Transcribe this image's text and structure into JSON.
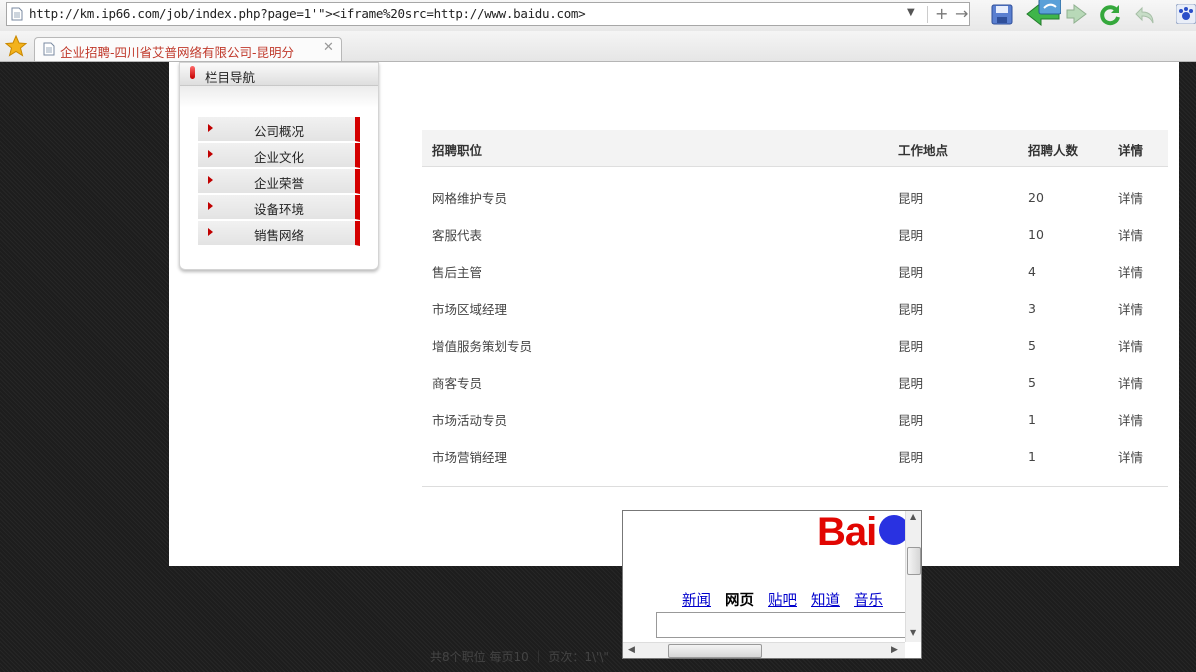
{
  "browser": {
    "url": "http://km.ip66.com/job/index.php?page=1'\"><iframe%20src=http://www.baidu.com>",
    "tab_title": "企业招聘-四川省艾普网络有限公司-昆明分",
    "icons": [
      "page-icon",
      "dropdown-arrow-icon",
      "add-icon",
      "go-arrow-icon",
      "save-icon",
      "back-icon",
      "forward-icon",
      "refresh-icon",
      "undo-icon",
      "paw-icon",
      "favorite-star-icon",
      "close-tab-icon"
    ]
  },
  "sidebar": {
    "title": "栏目导航",
    "items": [
      {
        "label": "公司概况"
      },
      {
        "label": "企业文化"
      },
      {
        "label": "企业荣誉"
      },
      {
        "label": "设备环境"
      },
      {
        "label": "销售网络"
      }
    ]
  },
  "jobs": {
    "columns": [
      "招聘职位",
      "工作地点",
      "招聘人数",
      "详情"
    ],
    "rows": [
      {
        "title": "网格维护专员",
        "location": "昆明",
        "count": "20",
        "detail": "详情"
      },
      {
        "title": "客服代表",
        "location": "昆明",
        "count": "10",
        "detail": "详情"
      },
      {
        "title": "售后主管",
        "location": "昆明",
        "count": "4",
        "detail": "详情"
      },
      {
        "title": "市场区域经理",
        "location": "昆明",
        "count": "3",
        "detail": "详情"
      },
      {
        "title": "增值服务策划专员",
        "location": "昆明",
        "count": "5",
        "detail": "详情"
      },
      {
        "title": "商客专员",
        "location": "昆明",
        "count": "5",
        "detail": "详情"
      },
      {
        "title": "市场活动专员",
        "location": "昆明",
        "count": "1",
        "detail": "详情"
      },
      {
        "title": "市场营销经理",
        "location": "昆明",
        "count": "1",
        "detail": "详情"
      }
    ],
    "pager": "共8个职位 每页10 ｜ 页次：1\\'\\\""
  },
  "iframe": {
    "logo_text": "Bai",
    "nav": [
      "新闻",
      "网页",
      "贴吧",
      "知道",
      "音乐"
    ],
    "active_nav": "网页"
  },
  "colors": {
    "accent_red": "#d40000",
    "link_blue": "#0000cc",
    "tab_title": "#c0392b",
    "backdrop": "#222222"
  }
}
